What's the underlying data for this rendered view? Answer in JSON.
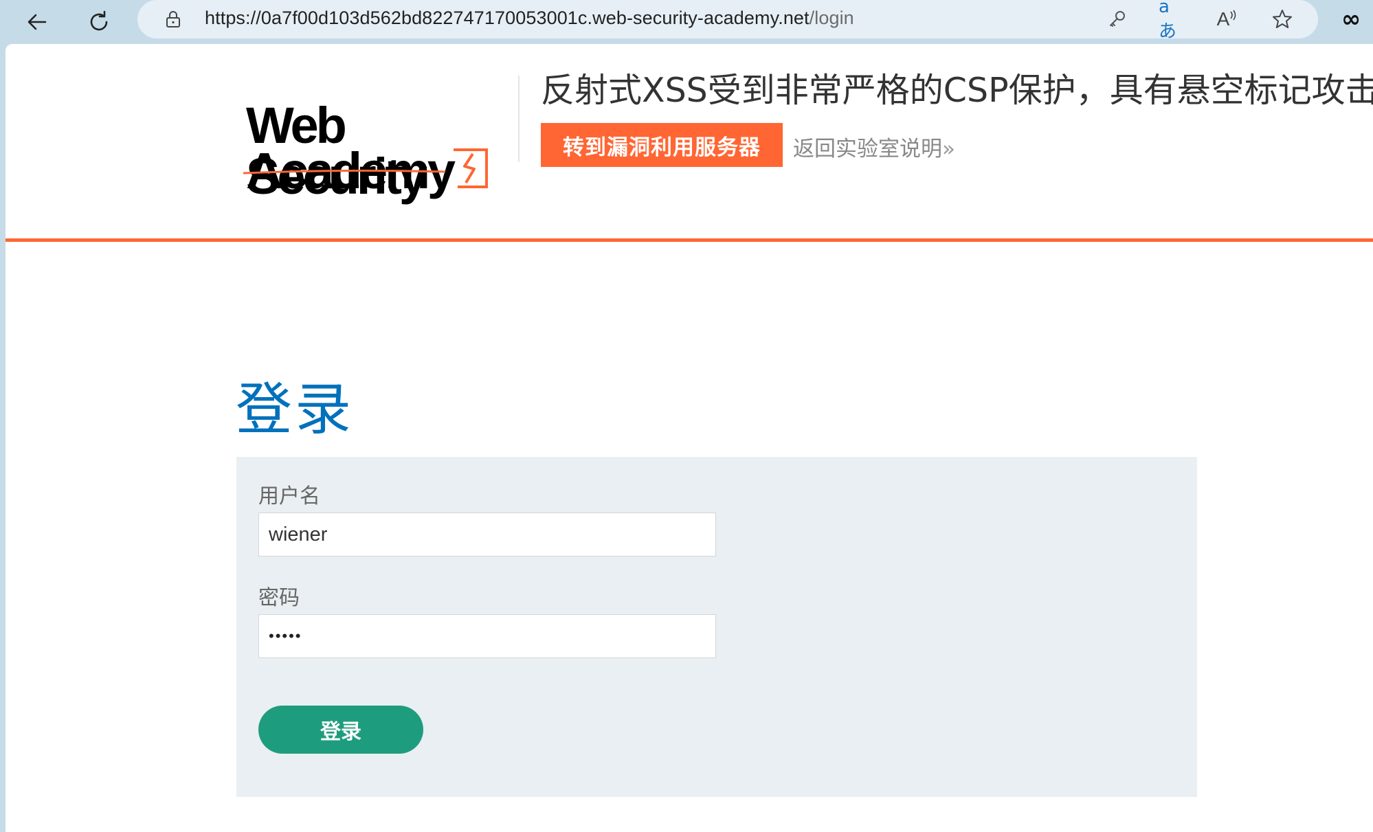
{
  "browser": {
    "url_host": "https://0a7f00d103d562bd822747170053001c.web-security-academy.net",
    "url_path": "/login",
    "icons": [
      "back-arrow-icon",
      "reload-icon",
      "lock-icon",
      "key-icon",
      "translate-icon",
      "read-aloud-icon",
      "star-icon",
      "infinity-icon"
    ],
    "translate_label": "aあ",
    "read_aloud_label": "A",
    "infinity_label": "∞"
  },
  "header": {
    "logo_line1": "Web Security",
    "logo_line2": "Academy",
    "lab_title": "反射式XSS受到非常严格的CSP保护，具有悬空标记攻击",
    "exploit_button": "转到漏洞利用服务器",
    "back_link": "返回实验室说明",
    "back_link_chevron": "»",
    "accent_color": "#ff6633"
  },
  "login": {
    "heading": "登录",
    "username_label": "用户名",
    "username_value": "wiener",
    "password_label": "密码",
    "password_value": "•••••",
    "submit_label": "登录",
    "heading_color": "#0071bc",
    "button_color": "#1e9d7e"
  }
}
